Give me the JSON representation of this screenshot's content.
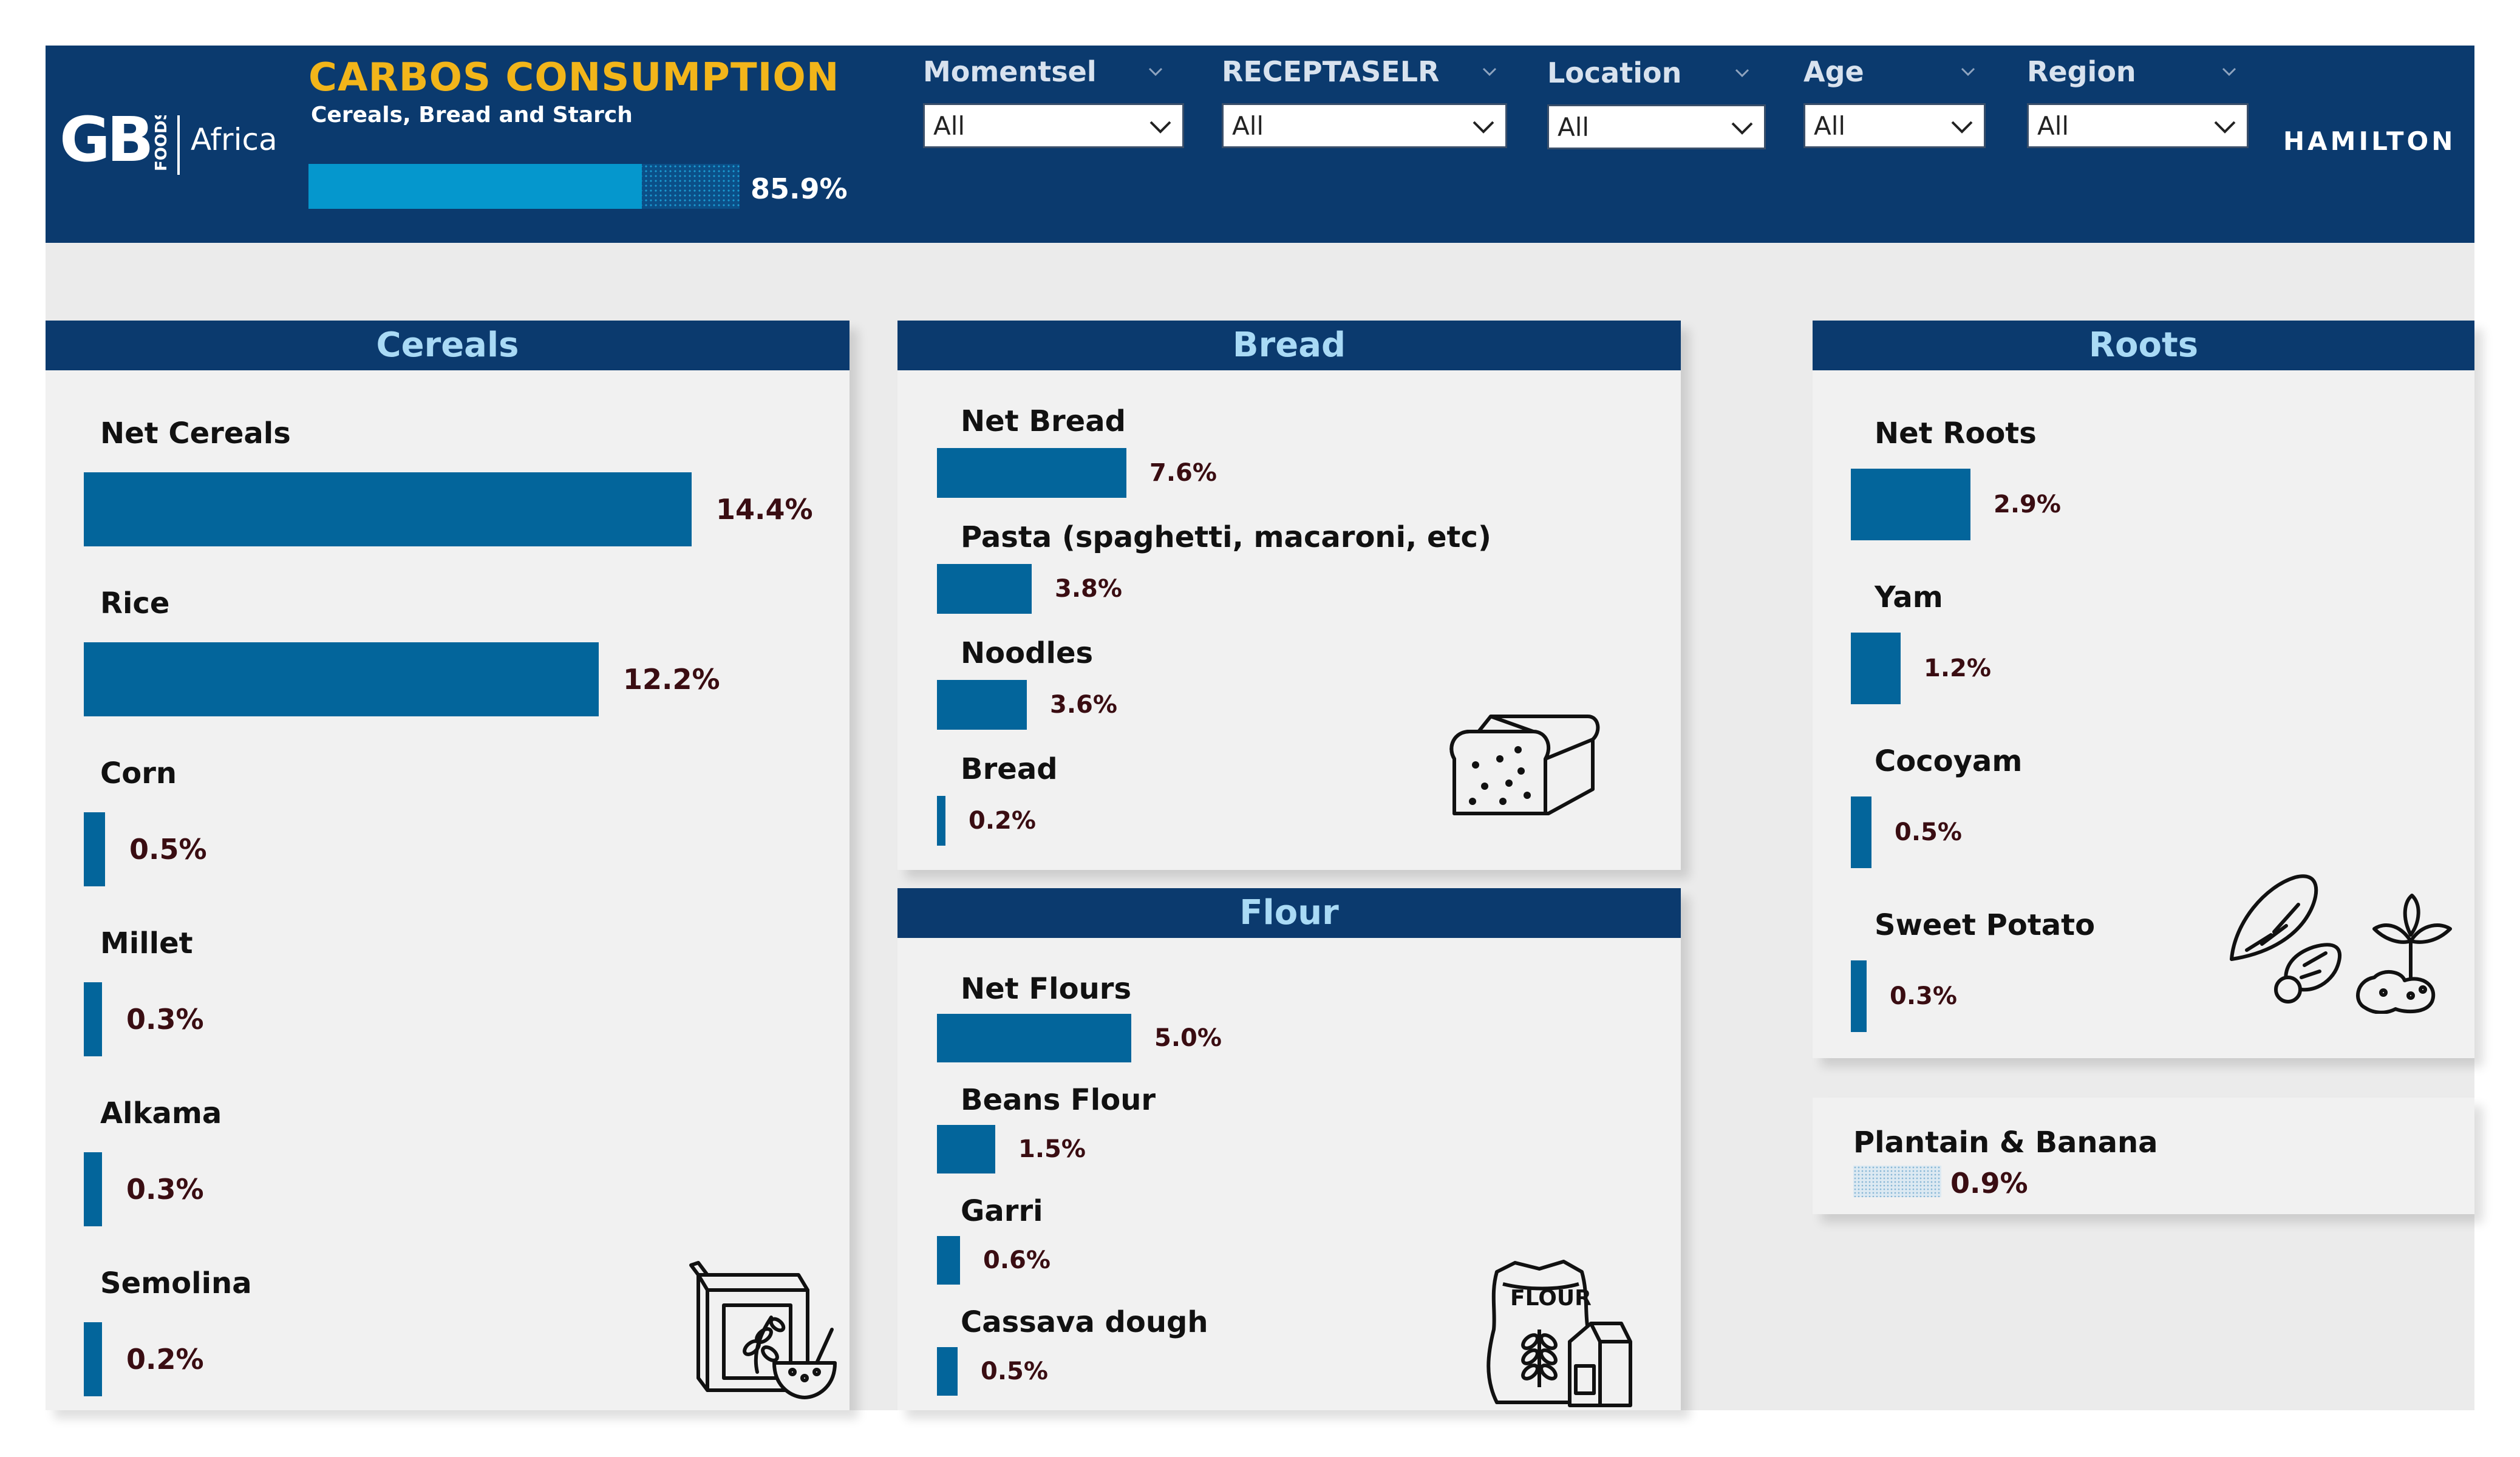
{
  "header": {
    "brand": "GB",
    "brand_sub": "FOODS",
    "brand_region": "Africa",
    "title": "CARBOS CONSUMPTION",
    "subtitle": "Cereals, Bread and Starch",
    "progress_value": 0.859,
    "progress_label": "85.9%",
    "store": "HAMILTON",
    "filters": [
      {
        "label": "Momentsel",
        "value": "All"
      },
      {
        "label": "RECEPTASELR",
        "value": "All"
      },
      {
        "label": "Location",
        "value": "All"
      },
      {
        "label": "Age",
        "value": "All"
      },
      {
        "label": "Region",
        "value": "All"
      }
    ]
  },
  "cereals": {
    "title": "Cereals",
    "items": [
      {
        "label": "Net Cereals",
        "value": 14.4,
        "display": "14.4%"
      },
      {
        "label": "Rice",
        "value": 12.2,
        "display": "12.2%"
      },
      {
        "label": "Corn",
        "value": 0.5,
        "display": "0.5%"
      },
      {
        "label": "Millet",
        "value": 0.3,
        "display": "0.3%"
      },
      {
        "label": "Alkama",
        "value": 0.3,
        "display": "0.3%"
      },
      {
        "label": "Semolina",
        "value": 0.2,
        "display": "0.2%"
      }
    ],
    "icon": "cereal-box-icon"
  },
  "bread": {
    "title": "Bread",
    "items": [
      {
        "label": "Net Bread",
        "value": 7.6,
        "display": "7.6%"
      },
      {
        "label": "Pasta (spaghetti, macaroni, etc)",
        "value": 3.8,
        "display": "3.8%"
      },
      {
        "label": "Noodles",
        "value": 3.6,
        "display": "3.6%"
      },
      {
        "label": "Bread",
        "value": 0.2,
        "display": "0.2%"
      }
    ],
    "icon": "bread-loaf-icon"
  },
  "flour": {
    "title": "Flour",
    "items": [
      {
        "label": "Net Flours",
        "value": 5.0,
        "display": "5.0%"
      },
      {
        "label": "Beans Flour",
        "value": 1.5,
        "display": "1.5%"
      },
      {
        "label": "Garri",
        "value": 0.6,
        "display": "0.6%"
      },
      {
        "label": "Cassava dough",
        "value": 0.5,
        "display": "0.5%"
      }
    ],
    "icon": "flour-sack-icon",
    "icon_text": "FLOUR"
  },
  "roots": {
    "title": "Roots",
    "items": [
      {
        "label": "Net Roots",
        "value": 2.9,
        "display": "2.9%"
      },
      {
        "label": "Yam",
        "value": 1.2,
        "display": "1.2%"
      },
      {
        "label": "Cocoyam",
        "value": 0.5,
        "display": "0.5%"
      },
      {
        "label": "Sweet Potato",
        "value": 0.3,
        "display": "0.3%"
      }
    ],
    "icon": "roots-vegetables-icon"
  },
  "plantain": {
    "label": "Plantain & Banana",
    "value": 0.9,
    "display": "0.9%"
  },
  "colors": {
    "header_bg": "#0b3a6e",
    "accent_title": "#f2b51a",
    "bar": "#03659b",
    "panel_bg": "#f1f1f1",
    "panel_title": "#a9daf5",
    "value_text": "#3a0d12"
  }
}
